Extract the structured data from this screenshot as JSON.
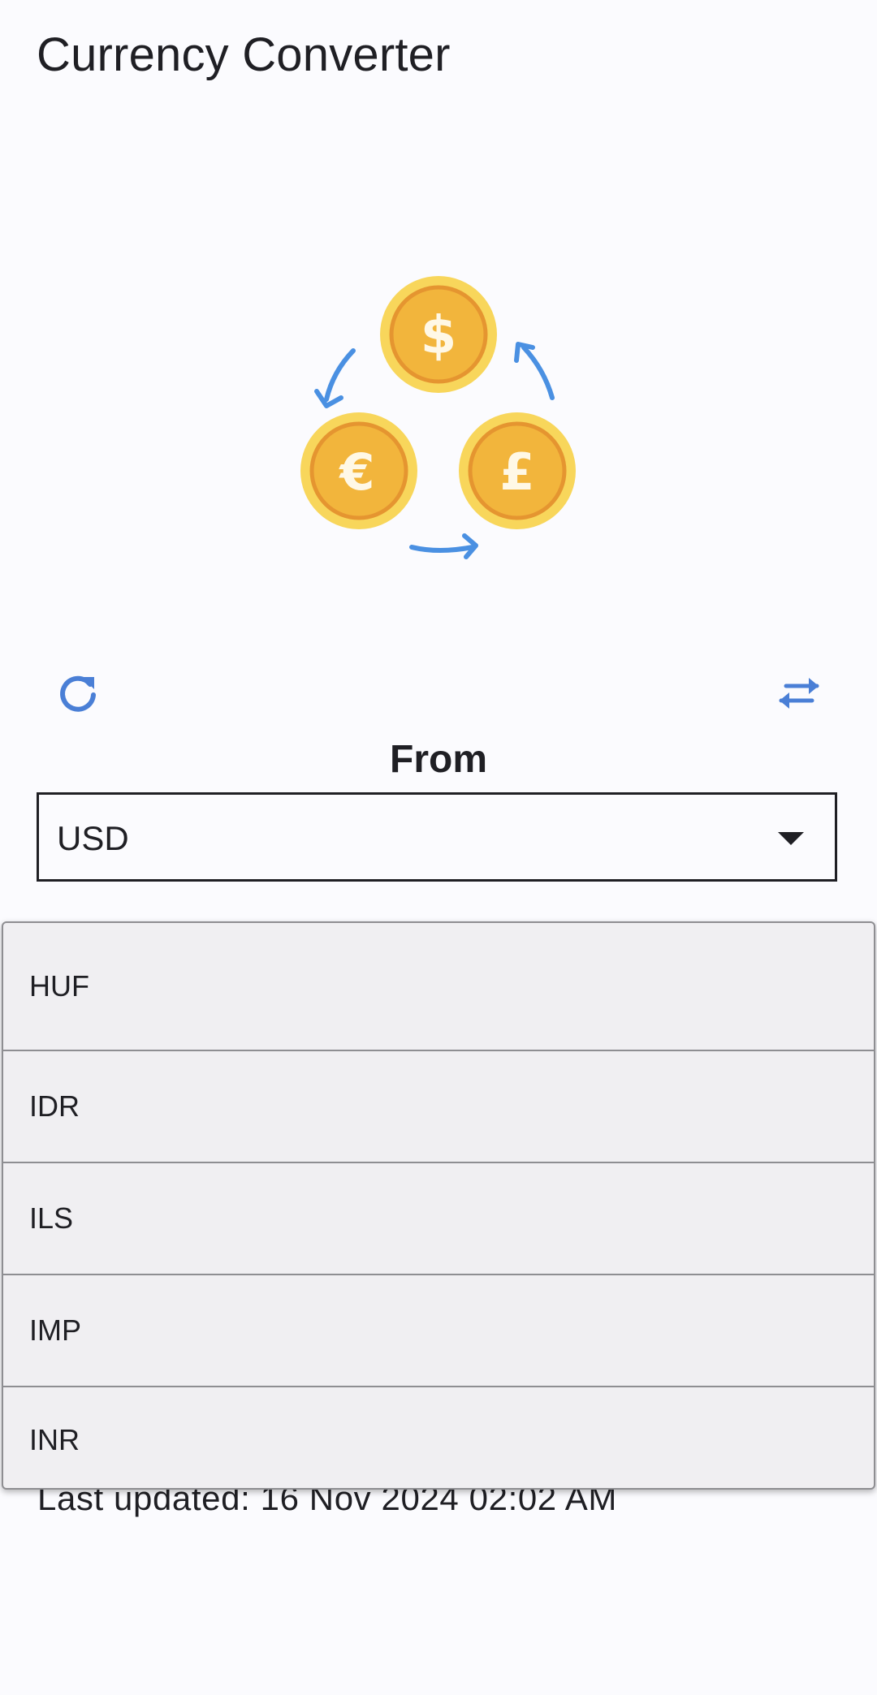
{
  "app": {
    "title": "Currency Converter"
  },
  "hero": {
    "icon": "currency-exchange-coins-icon",
    "coins": [
      "dollar",
      "euro",
      "pound"
    ],
    "colors": {
      "coin_outer": "#f8d65b",
      "coin_inner": "#f2b53c",
      "coin_ring": "#e59530",
      "arrows": "#4a90e2"
    }
  },
  "toolbar": {
    "refresh_icon": "refresh-icon",
    "swap_icon": "swap-arrows-icon",
    "icon_color": "#4a7fd6"
  },
  "converter": {
    "from_label": "From",
    "from_value": "USD"
  },
  "dropdown": {
    "options": [
      "HUF",
      "IDR",
      "ILS",
      "IMP",
      "INR"
    ]
  },
  "status": {
    "last_updated": "Last updated: 16 Nov 2024 02:02 AM"
  }
}
